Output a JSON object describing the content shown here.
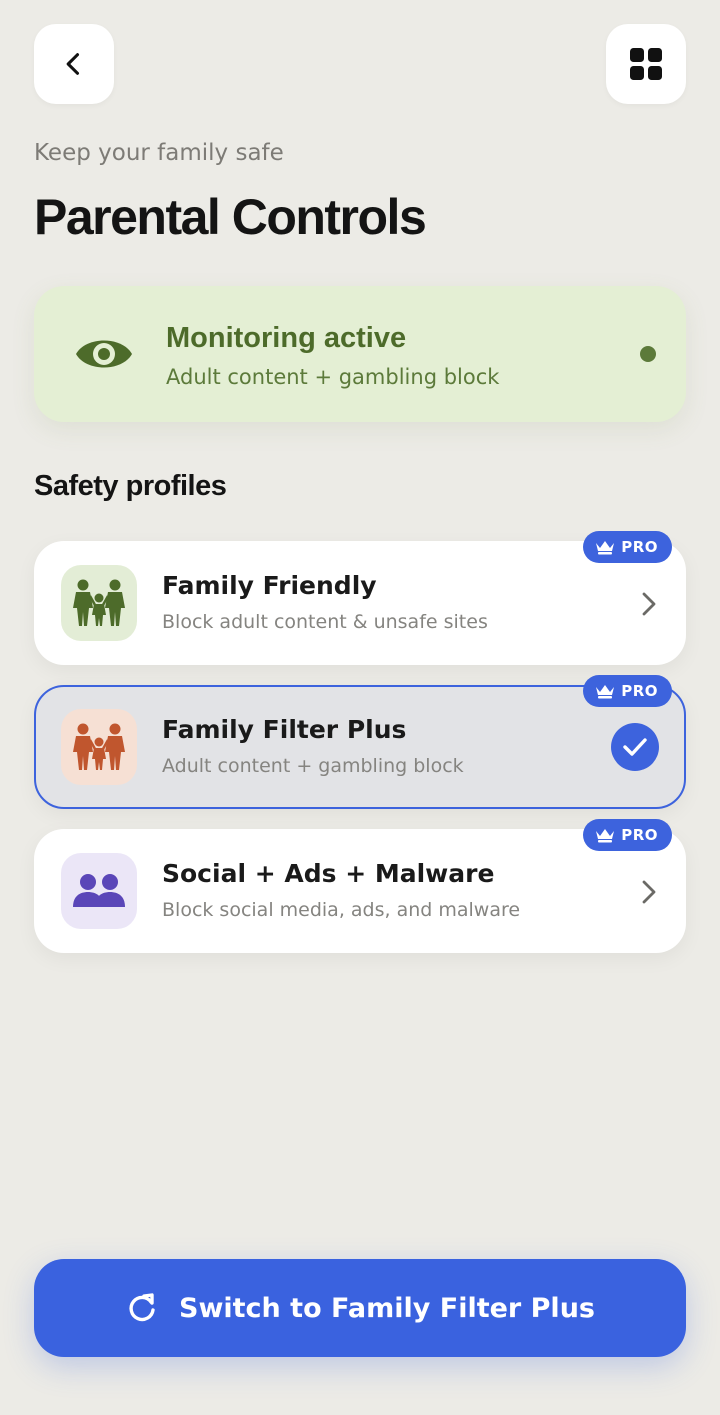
{
  "header": {
    "back_icon": "chevron-left-icon",
    "grid_icon": "grid-icon",
    "subtitle": "Keep your family safe",
    "title": "Parental Controls"
  },
  "status": {
    "icon": "eye-icon",
    "title": "Monitoring active",
    "subtitle": "Adult content + gambling block",
    "indicator_color": "#5c7a3a"
  },
  "section_title": "Safety profiles",
  "profiles": [
    {
      "name": "Family Friendly",
      "description": "Block adult content & unsafe sites",
      "badge": "PRO",
      "icon": "family-icon",
      "icon_color": "#4d6b2a",
      "icon_bg": "#e3edd6",
      "selected": false
    },
    {
      "name": "Family Filter Plus",
      "description": "Adult content + gambling block",
      "badge": "PRO",
      "icon": "family-icon",
      "icon_color": "#c0562e",
      "icon_bg": "#f6e0d4",
      "selected": true
    },
    {
      "name": "Social + Ads + Malware",
      "description": "Block social media, ads, and malware",
      "badge": "PRO",
      "icon": "users-icon",
      "icon_color": "#5a46b8",
      "icon_bg": "#ebe6f7",
      "selected": false
    }
  ],
  "cta": {
    "label": "Switch to Family Filter Plus",
    "icon": "refresh-icon"
  },
  "colors": {
    "accent": "#3a62df",
    "background": "#ecebe6",
    "status_bg": "#e4efd4"
  }
}
